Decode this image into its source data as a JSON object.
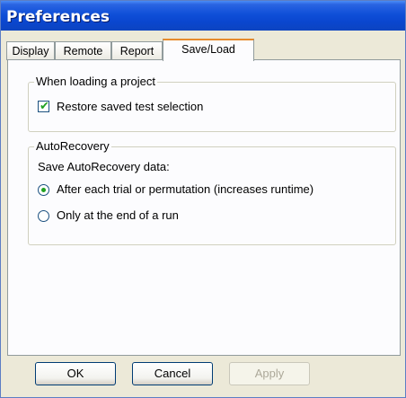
{
  "window": {
    "title": "Preferences"
  },
  "tabs": [
    {
      "label": "Display"
    },
    {
      "label": "Remote"
    },
    {
      "label": "Report"
    },
    {
      "label": "Save/Load",
      "active": true
    }
  ],
  "loading_group": {
    "legend": "When loading a project",
    "restore_checkbox": {
      "label": "Restore saved test selection",
      "checked": true
    }
  },
  "autorecovery_group": {
    "legend": "AutoRecovery",
    "prompt": "Save AutoRecovery data:",
    "options": [
      {
        "label": "After each trial or permutation (increases runtime)",
        "selected": true
      },
      {
        "label": "Only at the end of a run",
        "selected": false
      }
    ]
  },
  "buttons": {
    "ok": "OK",
    "cancel": "Cancel",
    "apply": "Apply"
  },
  "colors": {
    "title_bar": "#0a46cf",
    "active_tab_accent": "#e68b2c",
    "check_mark": "#21a121"
  }
}
